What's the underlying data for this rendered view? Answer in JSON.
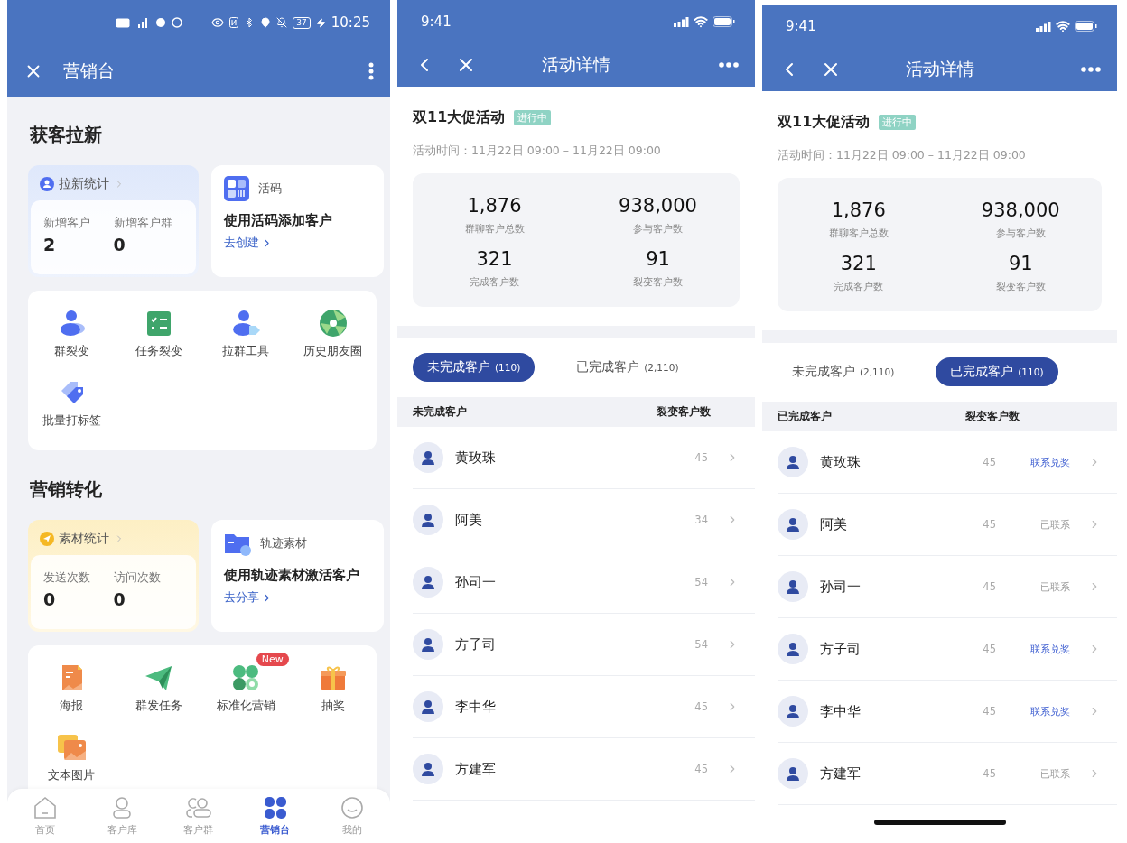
{
  "marketing": {
    "status_time": "10:25",
    "battery": "37",
    "title": "营销台",
    "sections": [
      {
        "kind": "acquire",
        "title": "获客拉新",
        "stat_card": {
          "title": "拉新统计",
          "metrics": [
            {
              "label": "新增客户",
              "value": "2"
            },
            {
              "label": "新增客户群",
              "value": "0"
            }
          ]
        },
        "promo_card": {
          "title": "活码",
          "headline": "使用活码添加客户",
          "link": "去创建"
        },
        "tools": [
          {
            "label": "群裂变"
          },
          {
            "label": "任务裂变"
          },
          {
            "label": "拉群工具"
          },
          {
            "label": "历史朋友圈"
          },
          {
            "label": "批量打标签"
          }
        ]
      },
      {
        "kind": "convert",
        "title": "营销转化",
        "stat_card": {
          "title": "素材统计",
          "metrics": [
            {
              "label": "发送次数",
              "value": "0"
            },
            {
              "label": "访问次数",
              "value": "0"
            }
          ]
        },
        "promo_card": {
          "title": "轨迹素材",
          "headline": "使用轨迹素材激活客户",
          "link": "去分享"
        },
        "tools": [
          {
            "label": "海报"
          },
          {
            "label": "群发任务"
          },
          {
            "label": "标准化营销",
            "badge": "New"
          },
          {
            "label": "抽奖"
          },
          {
            "label": "文本图片"
          }
        ]
      }
    ],
    "tab_bar": [
      {
        "label": "首页",
        "selected": false
      },
      {
        "label": "客户库",
        "selected": false
      },
      {
        "label": "客户群",
        "selected": false
      },
      {
        "label": "营销台",
        "selected": true
      },
      {
        "label": "我的",
        "selected": false
      }
    ]
  },
  "detail_screens": [
    {
      "status_time": "9:41",
      "title": "活动详情",
      "activity": {
        "name": "双11大促活动",
        "status": "进行中",
        "time": "活动时间：11月22日 09:00 – 11月22日 09:00"
      },
      "stats": [
        {
          "value": "1,876",
          "label": "群聊客户总数"
        },
        {
          "value": "938,000",
          "label": "参与客户数"
        },
        {
          "value": "321",
          "label": "完成客户数"
        },
        {
          "value": "91",
          "label": "裂变客户数"
        }
      ],
      "tabs": [
        {
          "label": "未完成客户",
          "count": "(110)",
          "selected": true
        },
        {
          "label": "已完成客户",
          "count": "(2,110)",
          "selected": false
        }
      ],
      "table": {
        "columns": [
          "未完成客户",
          "裂变客户数"
        ],
        "rows": [
          {
            "name": "黄玫珠",
            "count": "45"
          },
          {
            "name": "阿美",
            "count": "34"
          },
          {
            "name": "孙司一",
            "count": "54"
          },
          {
            "name": "方子司",
            "count": "54"
          },
          {
            "name": "李中华",
            "count": "45"
          },
          {
            "name": "方建军",
            "count": "45"
          }
        ]
      }
    },
    {
      "status_time": "9:41",
      "title": "活动详情",
      "home_indicator": true,
      "activity": {
        "name": "双11大促活动",
        "status": "进行中",
        "time": "活动时间：11月22日 09:00 – 11月22日 09:00"
      },
      "stats": [
        {
          "value": "1,876",
          "label": "群聊客户总数"
        },
        {
          "value": "938,000",
          "label": "参与客户数"
        },
        {
          "value": "321",
          "label": "完成客户数"
        },
        {
          "value": "91",
          "label": "裂变客户数"
        }
      ],
      "tabs": [
        {
          "label": "未完成客户",
          "count": "(2,110)",
          "selected": false
        },
        {
          "label": "已完成客户",
          "count": "(110)",
          "selected": true
        }
      ],
      "table": {
        "columns": [
          "已完成客户",
          "裂变客户数"
        ],
        "rows": [
          {
            "name": "黄玫珠",
            "count": "45",
            "action": "联系兑奖",
            "contacted": false
          },
          {
            "name": "阿美",
            "count": "45",
            "action": "已联系",
            "contacted": true
          },
          {
            "name": "孙司一",
            "count": "45",
            "action": "已联系",
            "contacted": true
          },
          {
            "name": "方子司",
            "count": "45",
            "action": "联系兑奖",
            "contacted": false
          },
          {
            "name": "李中华",
            "count": "45",
            "action": "联系兑奖",
            "contacted": false
          },
          {
            "name": "方建军",
            "count": "45",
            "action": "已联系",
            "contacted": true
          }
        ]
      }
    }
  ]
}
